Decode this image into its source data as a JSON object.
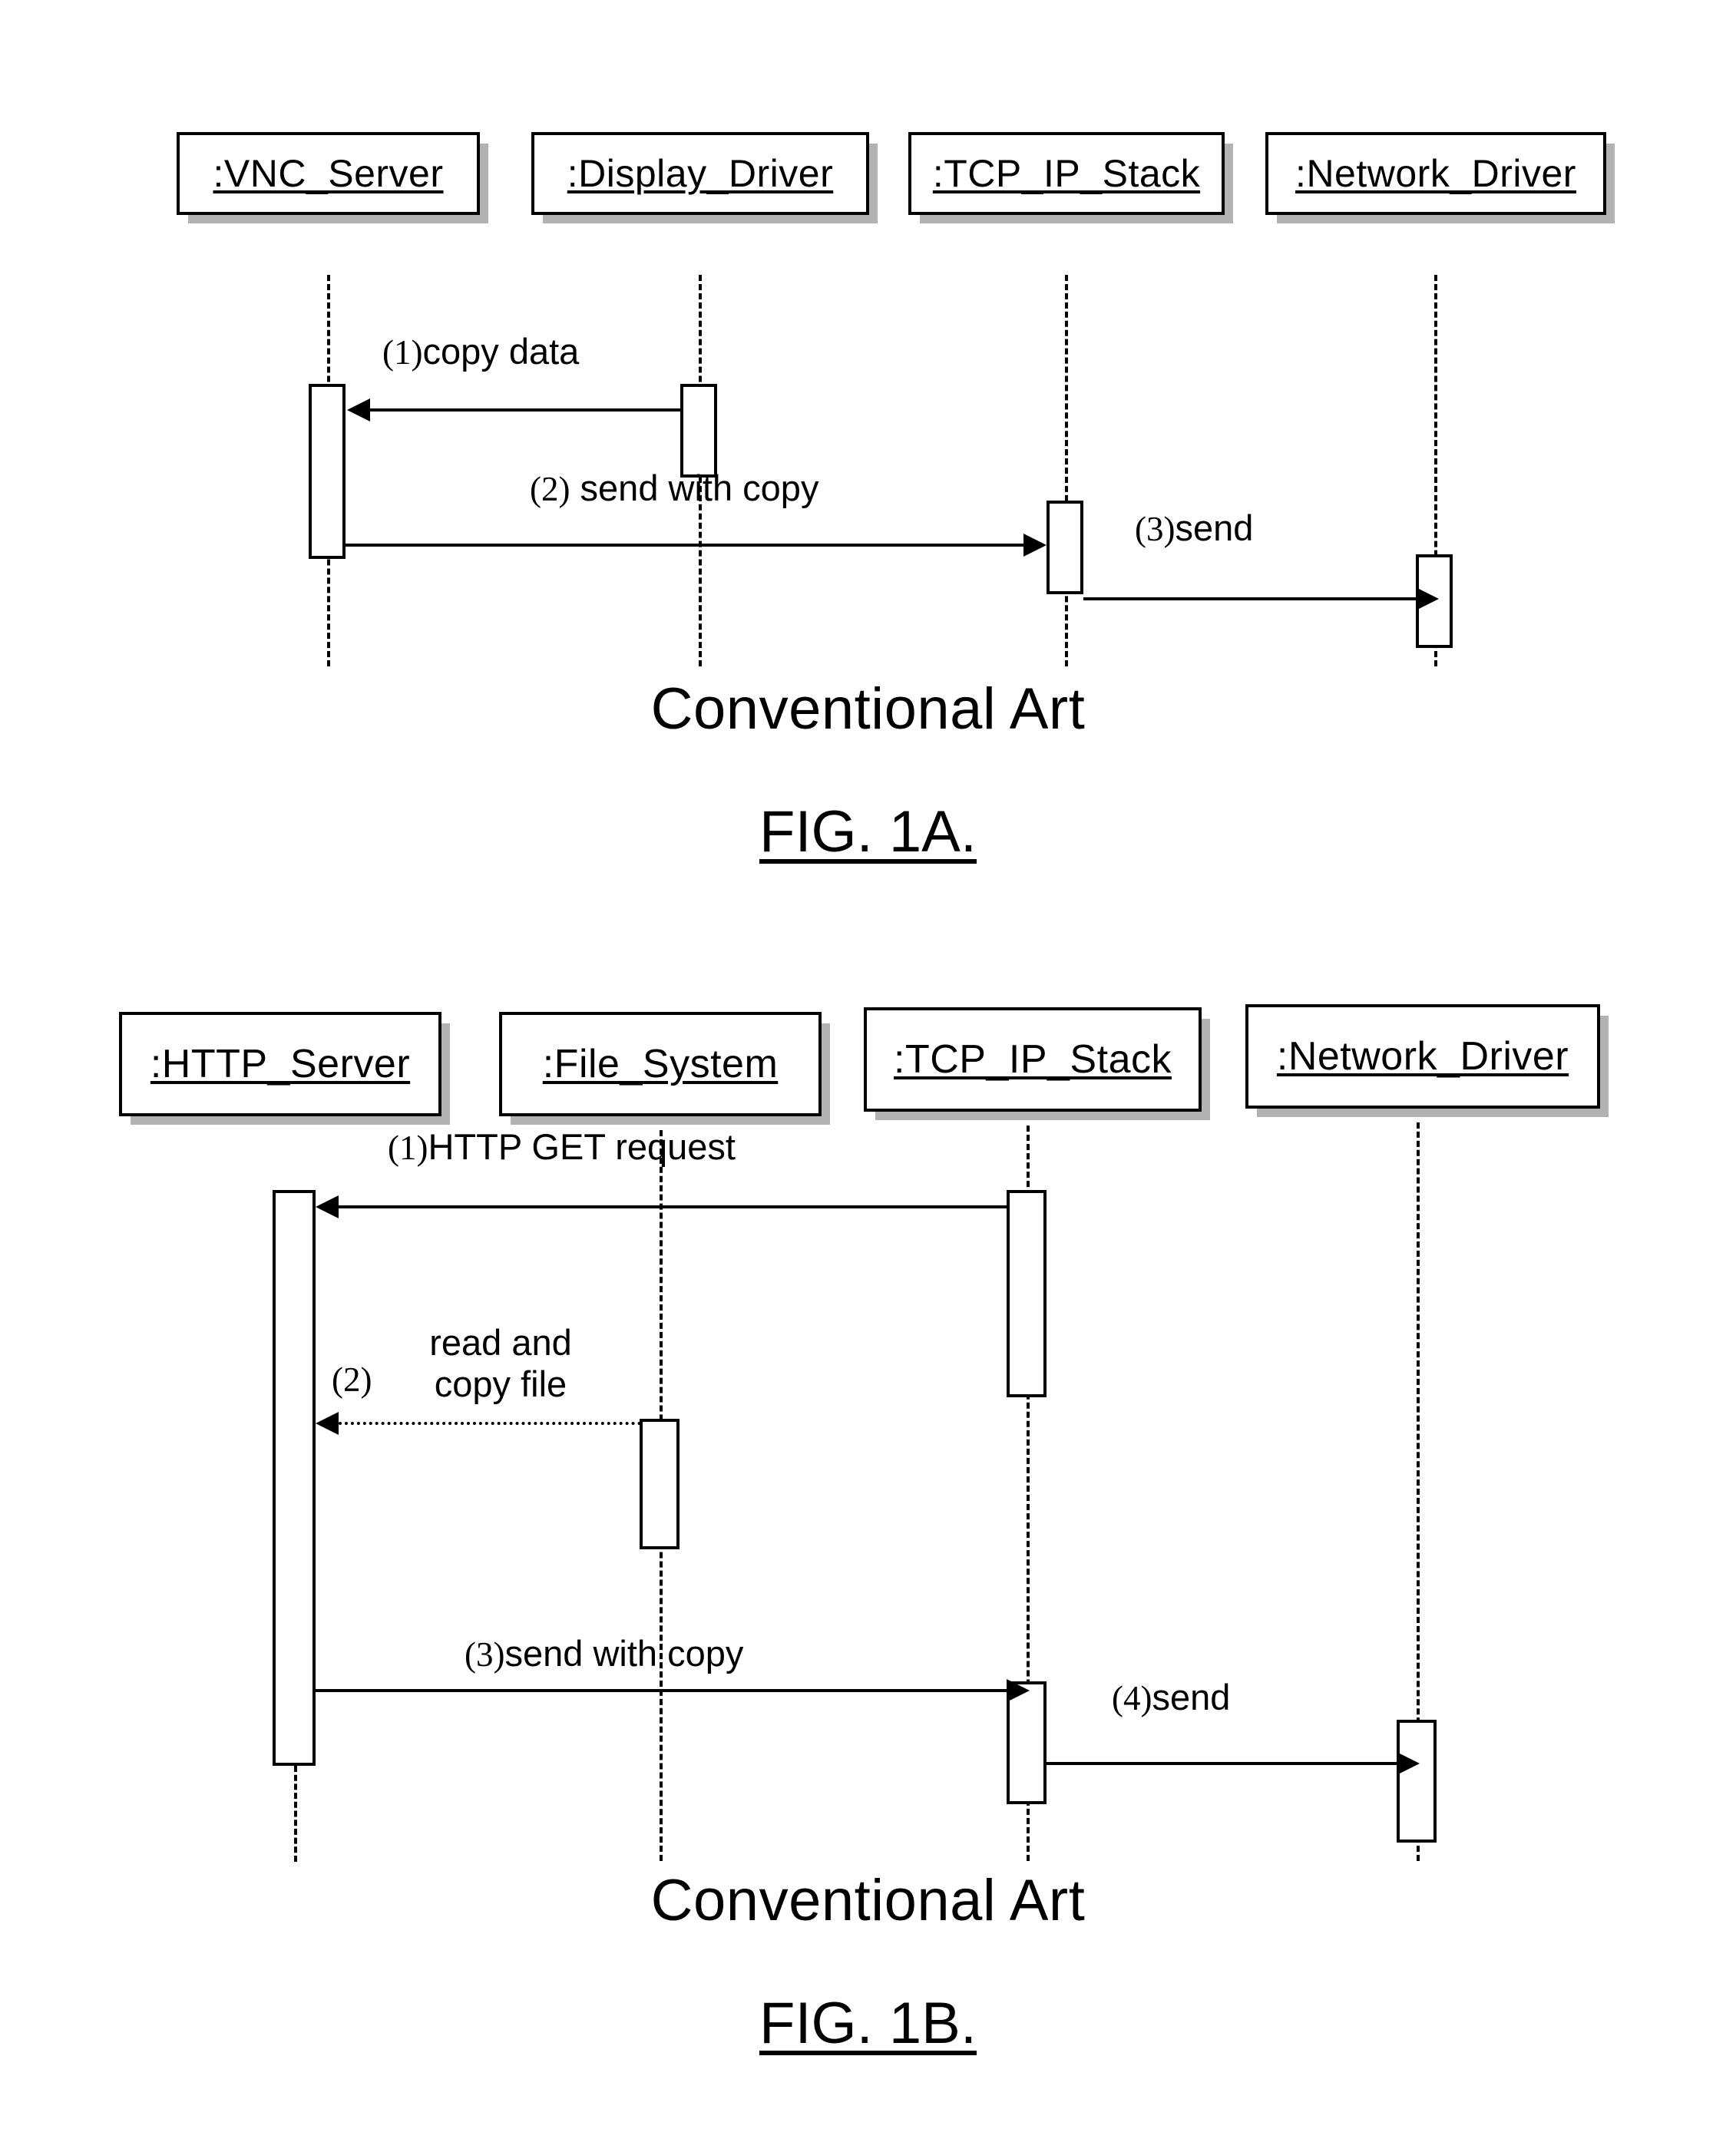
{
  "figure_1a": {
    "objects": [
      {
        "label": ":VNC_Server"
      },
      {
        "label": ":Display_Driver"
      },
      {
        "label": ":TCP_IP_Stack"
      },
      {
        "label": ":Network_Driver"
      }
    ],
    "messages": [
      {
        "number": "(1)",
        "text": "copy data",
        "from": ":Display_Driver",
        "to": ":VNC_Server",
        "direction": "left"
      },
      {
        "number": "(2)",
        "text": "send with copy",
        "from": ":VNC_Server",
        "to": ":TCP_IP_Stack",
        "direction": "right"
      },
      {
        "number": "(3)",
        "text": "send",
        "from": ":TCP_IP_Stack",
        "to": ":Network_Driver",
        "direction": "right"
      }
    ],
    "art_caption": "Conventional Art",
    "figure_caption": "FIG. 1A."
  },
  "figure_1b": {
    "objects": [
      {
        "label": ":HTTP_Server"
      },
      {
        "label": ":File_System"
      },
      {
        "label": ":TCP_IP_Stack"
      },
      {
        "label": ":Network_Driver"
      }
    ],
    "messages": [
      {
        "number": "(1)",
        "text": "HTTP GET request",
        "from": ":TCP_IP_Stack",
        "to": ":HTTP_Server",
        "direction": "left"
      },
      {
        "number": "(2)",
        "text_line1": "read and",
        "text_line2": "copy file",
        "from": ":File_System",
        "to": ":HTTP_Server",
        "direction": "left"
      },
      {
        "number": "(3)",
        "text": "send with copy",
        "from": ":HTTP_Server",
        "to": ":TCP_IP_Stack",
        "direction": "right"
      },
      {
        "number": "(4)",
        "text": "send",
        "from": ":TCP_IP_Stack",
        "to": ":Network_Driver",
        "direction": "right"
      }
    ],
    "art_caption": "Conventional Art",
    "figure_caption": "FIG. 1B."
  },
  "colors": {
    "ink": "#000000",
    "paper": "#ffffff"
  }
}
